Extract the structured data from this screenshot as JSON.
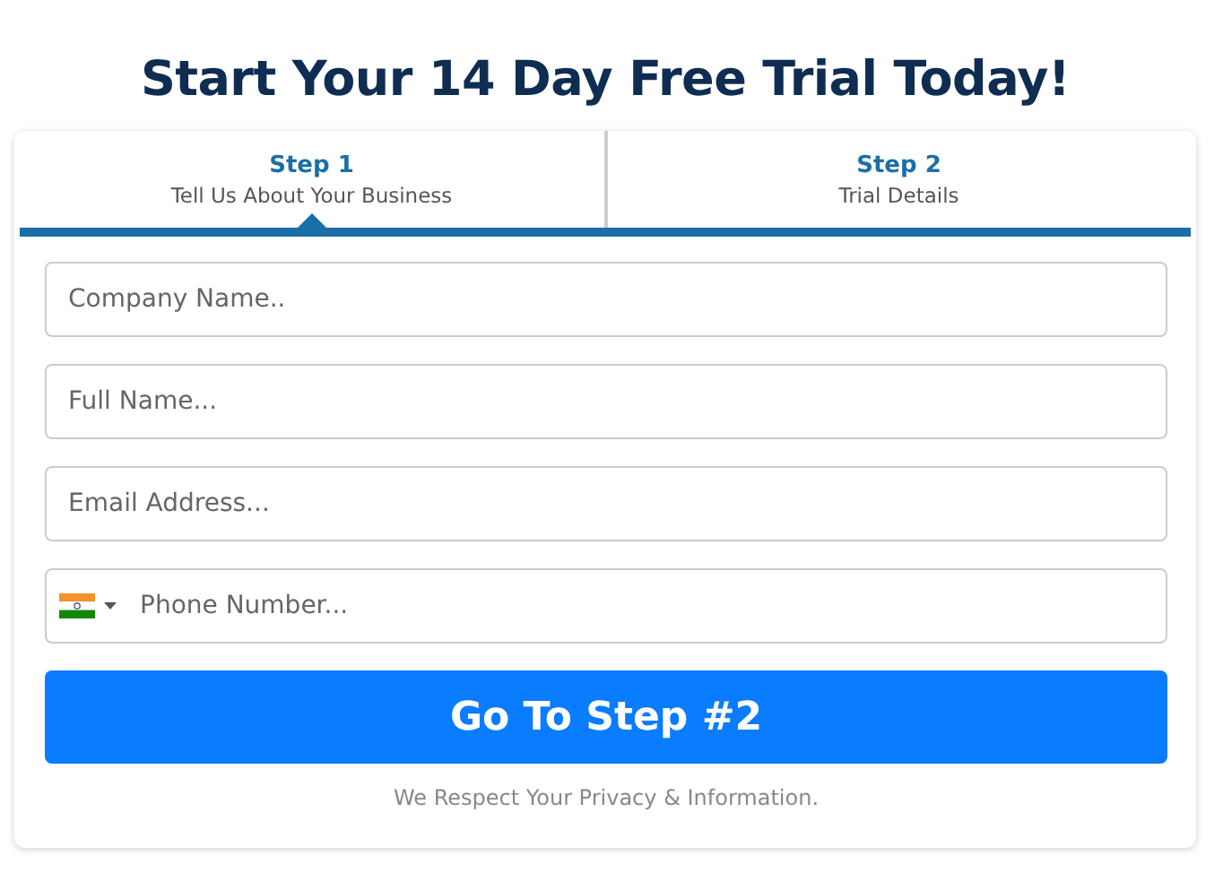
{
  "title": "Start Your 14 Day Free Trial Today!",
  "steps": [
    {
      "label": "Step 1",
      "caption": "Tell Us About Your Business",
      "selected": true
    },
    {
      "label": "Step 2",
      "caption": "Trial Details",
      "selected": false
    }
  ],
  "fields": [
    {
      "kind": "text",
      "placeholder": "Company Name.."
    },
    {
      "kind": "text",
      "placeholder": "Full Name..."
    },
    {
      "kind": "text",
      "placeholder": "Email Address..."
    },
    {
      "kind": "phone",
      "placeholder": "Phone Number..."
    }
  ],
  "submit": "Go To Step #2",
  "note": "We Respect Your Privacy & Information."
}
